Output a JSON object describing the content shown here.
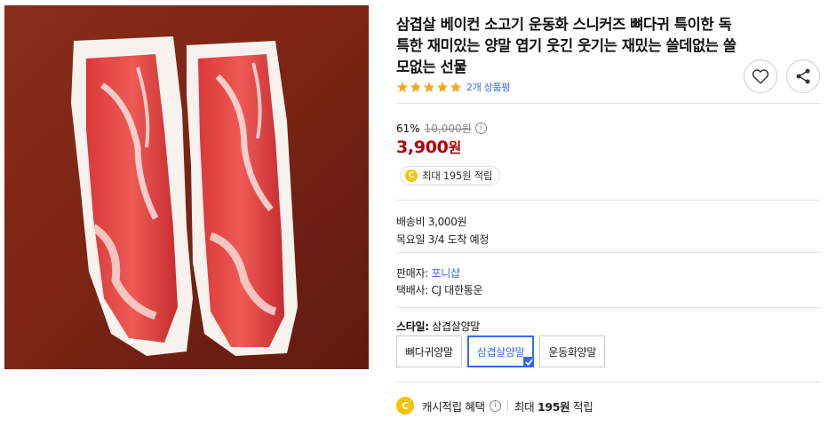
{
  "product": {
    "title": "삼겹살 베이컨 소고기 운동화 스니커즈 뼈다귀 특이한 독특한 재미있는 양말 엽기 웃긴 웃기는 재밌는 쓸데없는 쓸모없는 선물",
    "rating": 5,
    "review_count_text": "2개 상품평"
  },
  "price": {
    "discount_rate": "61%",
    "original_price": "10,000원",
    "sale_price": "3,900",
    "currency_unit": "원",
    "reward_text": "최대 195원 적립",
    "coin_symbol": "C"
  },
  "shipping": {
    "fee_text": "배송비 3,000원",
    "arrival_text": "목요일 3/4 도착 예정"
  },
  "seller": {
    "seller_label": "판매자: ",
    "seller_name": "포니샵",
    "courier_text": "택배사: CJ 대한통운"
  },
  "style": {
    "label": "스타일",
    "selected_value": "삼겹살양말",
    "options": [
      {
        "label": "뼈다귀양말",
        "selected": false
      },
      {
        "label": "삼겹살양말",
        "selected": true
      },
      {
        "label": "운동화양말",
        "selected": false
      }
    ]
  },
  "cash": {
    "label": "캐시적립 혜택",
    "max_text": "최대 ",
    "amount": "195원",
    "suffix": " 적립"
  },
  "icons": {
    "wish": "heart-icon",
    "share": "share-icon",
    "info": "info-icon",
    "coin": "coin-icon",
    "check": "check-icon"
  },
  "colors": {
    "accent": "#346aff",
    "price": "#ae0000",
    "star": "#f5a623",
    "coin": "#f5c400"
  }
}
